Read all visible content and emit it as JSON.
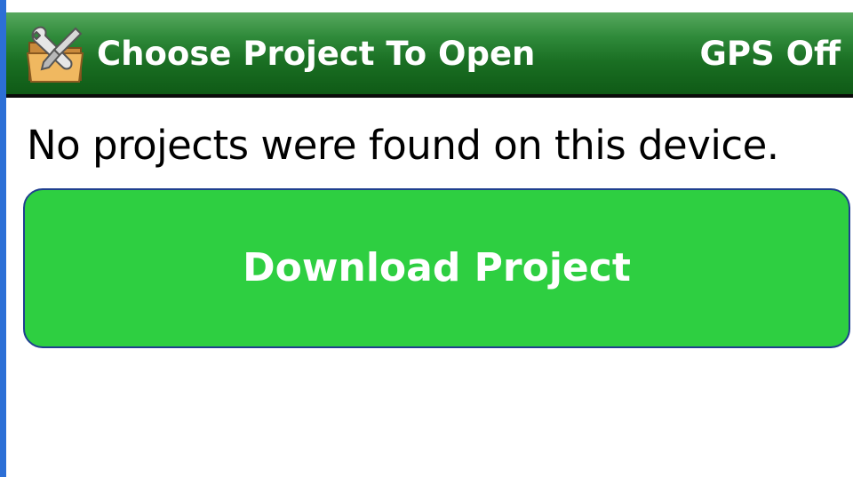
{
  "title_bar": {
    "title": "Choose Project To Open",
    "gps_status": "GPS Off",
    "icon": "folder-tools-icon"
  },
  "main": {
    "message": "No projects were found on this device.",
    "download_button_label": "Download Project"
  },
  "colors": {
    "title_bar_green": "#1a6f23",
    "button_green": "#2ecf41",
    "button_border": "#1f3f8f",
    "left_edge_blue": "#2c6fd6"
  }
}
